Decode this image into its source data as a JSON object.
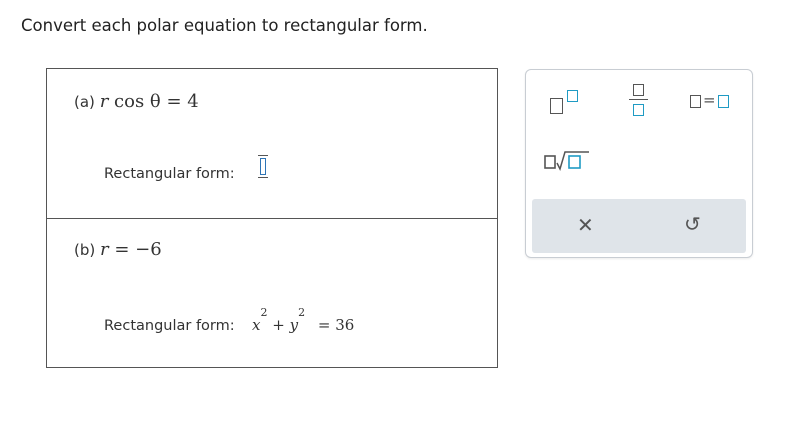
{
  "prompt": "Convert each polar equation to rectangular form.",
  "parts": [
    {
      "label": "(a)",
      "equation": {
        "lhs_var": "r",
        "func": "cos",
        "arg": "θ",
        "rhs": "= 4"
      },
      "rect_label": "Rectangular form:",
      "answer": ""
    },
    {
      "label": "(b)",
      "equation": {
        "lhs_var": "r",
        "rhs": "= −6"
      },
      "rect_label": "Rectangular form:",
      "answer": {
        "x": "x",
        "y": "y",
        "exp": "2",
        "plus": "+",
        "rhs": "= 36"
      }
    }
  ],
  "palette": {
    "buttons": [
      {
        "name": "exponent-template",
        "icon": "box-superscript-box-icon"
      },
      {
        "name": "fraction-template",
        "icon": "box-over-box-icon"
      },
      {
        "name": "equation-template",
        "icon": "box-equals-box-icon",
        "equals": "="
      },
      {
        "name": "nth-root-template",
        "icon": "box-root-box-icon"
      }
    ],
    "clear_glyph": "✕",
    "undo_glyph": "↺"
  },
  "colors": {
    "accent": "#1f9bc4",
    "answer_frame": "#2e74b5",
    "action_bar": "#dfe4e9"
  }
}
